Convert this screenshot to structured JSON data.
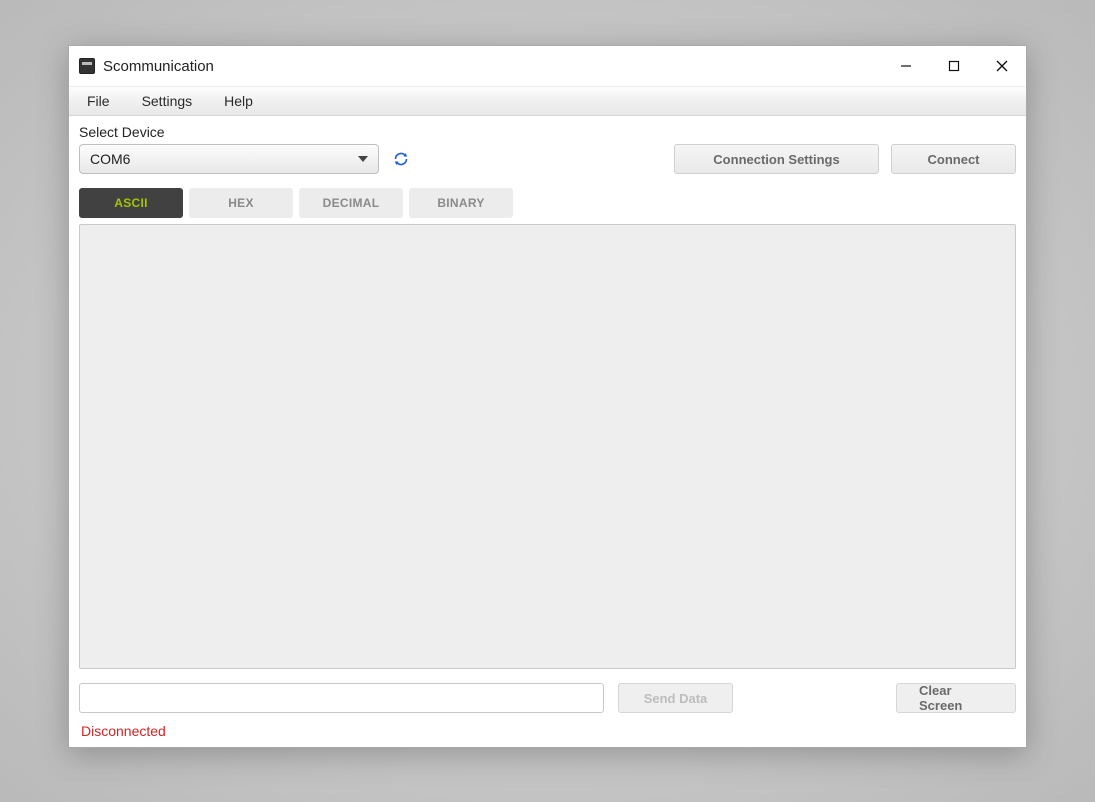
{
  "window": {
    "title": "Scommunication"
  },
  "menu": {
    "file": "File",
    "settings": "Settings",
    "help": "Help"
  },
  "device": {
    "label": "Select Device",
    "selected": "COM6"
  },
  "buttons": {
    "connection_settings": "Connection Settings",
    "connect": "Connect",
    "send_data": "Send Data",
    "clear_screen": "Clear Screen"
  },
  "tabs": [
    {
      "label": "ASCII",
      "active": true
    },
    {
      "label": "HEX",
      "active": false
    },
    {
      "label": "DECIMAL",
      "active": false
    },
    {
      "label": "BINARY",
      "active": false
    }
  ],
  "input": {
    "value": ""
  },
  "status": {
    "text": "Disconnected"
  }
}
